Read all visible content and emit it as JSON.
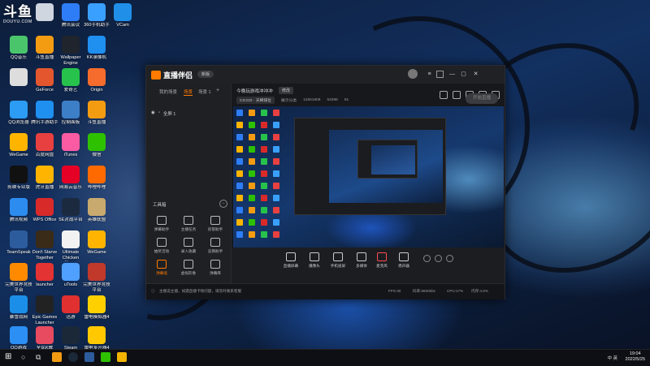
{
  "watermark": {
    "big": "斗鱼",
    "small": "DOUYU.COM"
  },
  "desktop_icons": [
    {
      "label": "",
      "color": "#cfd6e0",
      "icon": "computer-icon"
    },
    {
      "label": "腾讯会议",
      "color": "#2e7df6",
      "icon": "meeting-icon"
    },
    {
      "label": "360手机助手",
      "color": "#3aa0ff",
      "icon": "phone-assistant-icon"
    },
    {
      "label": "VCam",
      "color": "#1f8fe8",
      "icon": "camera-icon"
    },
    {
      "label": "QQ音乐",
      "color": "#4bc56c",
      "icon": "music-icon"
    },
    {
      "label": "斗鱼直播",
      "color": "#f39c12",
      "icon": "douyu-icon"
    },
    {
      "label": "Wallpaper Engine",
      "color": "#20242c",
      "icon": "wallpaper-icon"
    },
    {
      "label": "KK录像机",
      "color": "#1f8ff0",
      "icon": "recorder-icon"
    },
    {
      "label": "",
      "color": "#dddddd",
      "icon": "file-icon"
    },
    {
      "label": "GeForce",
      "color": "#e4572e",
      "icon": "game-icon"
    },
    {
      "label": "爱奇艺",
      "color": "#27c24c",
      "icon": "iqiyi-icon"
    },
    {
      "label": "Origin",
      "color": "#f56c2d",
      "icon": "origin-icon"
    },
    {
      "label": "QQ浏览器",
      "color": "#2c9cf4",
      "icon": "browser-icon"
    },
    {
      "label": "腾讯手游助手",
      "color": "#1f8ff0",
      "icon": "mobile-game-icon"
    },
    {
      "label": "控制面板",
      "color": "#3c7fc6",
      "icon": "control-panel-icon"
    },
    {
      "label": "斗鱼直播",
      "color": "#f39c12",
      "icon": "douyu-live-icon"
    },
    {
      "label": "WeGame",
      "color": "#ffb400",
      "icon": "wegame-icon"
    },
    {
      "label": "百度网盘",
      "color": "#e84040",
      "icon": "netdisk-icon"
    },
    {
      "label": "iTunes",
      "color": "#fa5ba2",
      "icon": "itunes-icon"
    },
    {
      "label": "微信",
      "color": "#2dc100",
      "icon": "wechat-icon"
    },
    {
      "label": "剪映专业版",
      "color": "#111111",
      "icon": "capcut-icon"
    },
    {
      "label": "虎牙直播",
      "color": "#ffb400",
      "icon": "huya-icon"
    },
    {
      "label": "网易云音乐",
      "color": "#e60026",
      "icon": "netease-music-icon"
    },
    {
      "label": "哔哩哔哩",
      "color": "#ff6a00",
      "icon": "bilibili-icon"
    },
    {
      "label": "腾讯视频",
      "color": "#2d8cf0",
      "icon": "tencent-video-icon"
    },
    {
      "label": "WPS Office",
      "color": "#d92a2a",
      "icon": "wps-icon"
    },
    {
      "label": "5E对战平台",
      "color": "#1c2a40",
      "icon": "5e-icon"
    },
    {
      "label": "英雄联盟",
      "color": "#c8aa6e",
      "icon": "lol-icon"
    },
    {
      "label": "TeamSpeak",
      "color": "#2d5c9c",
      "icon": "teamspeak-icon"
    },
    {
      "label": "Don't Starve Together",
      "color": "#3a2a18",
      "icon": "dont-starve-icon"
    },
    {
      "label": "Ultimate Chicken Horse",
      "color": "#f2f2f2",
      "icon": "chicken-horse-icon"
    },
    {
      "label": "WeGame",
      "color": "#ffb400",
      "icon": "wegame2-icon"
    },
    {
      "label": "完美世界竞技平台",
      "color": "#ff8a00",
      "icon": "perfect-world-icon"
    },
    {
      "label": "launcher",
      "color": "#e33333",
      "icon": "launcher-icon"
    },
    {
      "label": "uTools",
      "color": "#4fa0ff",
      "icon": "utools-icon"
    },
    {
      "label": "完美世界竞技平台",
      "color": "#c0392b",
      "icon": "pw-platform-icon"
    },
    {
      "label": "暴雪战网",
      "color": "#1b8fe8",
      "icon": "battlenet-icon"
    },
    {
      "label": "Epic Games Launcher",
      "color": "#222222",
      "icon": "epic-icon"
    },
    {
      "label": "迅游",
      "color": "#e03030",
      "icon": "accelerator-icon"
    },
    {
      "label": "雷电模拟器4",
      "color": "#ffd000",
      "icon": "emulator-icon"
    },
    {
      "label": "QQ游戏",
      "color": "#2b8ff4",
      "icon": "qq-game-icon"
    },
    {
      "label": "全民K歌",
      "color": "#e84a5f",
      "icon": "karaoke-icon"
    },
    {
      "label": "Steam",
      "color": "#1b2838",
      "icon": "steam-icon"
    },
    {
      "label": "雷电多开器4",
      "color": "#ffc800",
      "icon": "multi-emulator-icon"
    }
  ],
  "app": {
    "logo": "直播伴侣",
    "version": "新版",
    "tabs": [
      "我的场景",
      "场景",
      "场景 1"
    ],
    "scene_item": "全屏 1",
    "tools_title": "工具箱",
    "tools": [
      {
        "label": "弹幕助手",
        "hot": false
      },
      {
        "label": "主播任务",
        "hot": false
      },
      {
        "label": "房管助手",
        "hot": false
      },
      {
        "label": "抽奖活动",
        "hot": false
      },
      {
        "label": "录入收藏",
        "hot": false
      },
      {
        "label": "竞猜助手",
        "hot": false
      },
      {
        "label": "弹幕墙",
        "hot": true
      },
      {
        "label": "虚拟形象",
        "hot": false
      },
      {
        "label": "弹幕库",
        "hot": false
      }
    ],
    "room_title": "今晚玩游戏冲冲冲",
    "room_badge": "修改",
    "category": "CS:GO · 天梯排位",
    "info": [
      "展示分类",
      "12551808",
      "53386",
      "81"
    ],
    "controls": [
      "直播屏幕",
      "摄像头",
      "手机投屏",
      "多媒体",
      "麦克风",
      "扬声器"
    ],
    "go_live": "开始直播",
    "status": [
      "主播说主播，如遇直播卡顿问题，请及时联系客服",
      "FPS:30",
      "码率:6600kbs",
      "CPU:17%",
      "内存:4.8%"
    ]
  },
  "taskbar": {
    "tray": "中 英",
    "time": "19:04",
    "date": "2022/5/25"
  }
}
